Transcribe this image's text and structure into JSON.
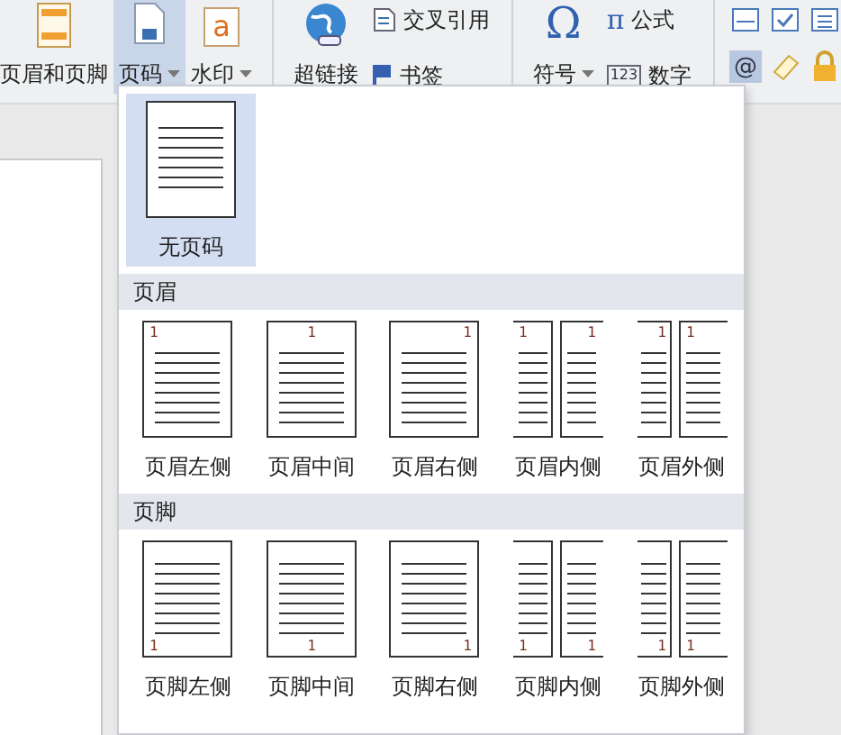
{
  "ribbon": [
    {
      "kind": "large",
      "label": "页眉和页脚",
      "dropdown": false,
      "selected": false
    },
    {
      "kind": "large",
      "label": "页码",
      "dropdown": true,
      "selected": true
    },
    {
      "kind": "large",
      "glyph": "a",
      "label": "水印",
      "dropdown": true,
      "selected": false
    },
    {
      "kind": "separator"
    },
    {
      "kind": "large",
      "label": "超链接",
      "dropdown": false,
      "selected": false
    },
    {
      "kind": "stack",
      "items": [
        {
          "label": "交叉引用"
        },
        {
          "label": "书签"
        }
      ]
    },
    {
      "kind": "separator"
    },
    {
      "kind": "large",
      "glyph": "Ω",
      "label": "符号",
      "dropdown": true,
      "selected": false
    },
    {
      "kind": "stack",
      "items": [
        {
          "glyph": "π",
          "label": "公式"
        },
        {
          "glyph": "123",
          "label": "数字"
        }
      ]
    },
    {
      "kind": "separator"
    },
    {
      "kind": "grid",
      "items": [
        {
          "selected": false
        },
        {
          "selected": false
        },
        {
          "selected": false
        },
        {
          "glyph": "@",
          "selected": true
        },
        {
          "selected": false
        },
        {
          "selected": false
        }
      ]
    }
  ],
  "menu": {
    "options": [
      {
        "label": "无页码",
        "kind": "none",
        "selected": true
      }
    ],
    "sections": [
      {
        "title": "页眉",
        "kind": "header",
        "options": [
          {
            "label": "页眉左侧",
            "kind": "left",
            "marks": [
              "1"
            ],
            "selected": false
          },
          {
            "label": "页眉中间",
            "kind": "center",
            "marks": [
              "1"
            ],
            "selected": false
          },
          {
            "label": "页眉右侧",
            "kind": "right",
            "marks": [
              "1"
            ],
            "selected": false
          },
          {
            "label": "页眉内侧",
            "kind": "inside",
            "marks": [
              "1",
              "1"
            ],
            "selected": false
          },
          {
            "label": "页眉外侧",
            "kind": "outside",
            "marks": [
              "1",
              "1"
            ],
            "selected": false
          }
        ]
      },
      {
        "title": "页脚",
        "kind": "footer",
        "options": [
          {
            "label": "页脚左侧",
            "kind": "left",
            "marks": [
              "1"
            ],
            "selected": false
          },
          {
            "label": "页脚中间",
            "kind": "center",
            "marks": [
              "1"
            ],
            "selected": false
          },
          {
            "label": "页脚右侧",
            "kind": "right",
            "marks": [
              "1"
            ],
            "selected": false
          },
          {
            "label": "页脚内侧",
            "kind": "inside",
            "marks": [
              "1",
              "1"
            ],
            "selected": false
          },
          {
            "label": "页脚外侧",
            "kind": "outside",
            "marks": [
              "1",
              "1"
            ],
            "selected": false
          }
        ]
      }
    ]
  }
}
